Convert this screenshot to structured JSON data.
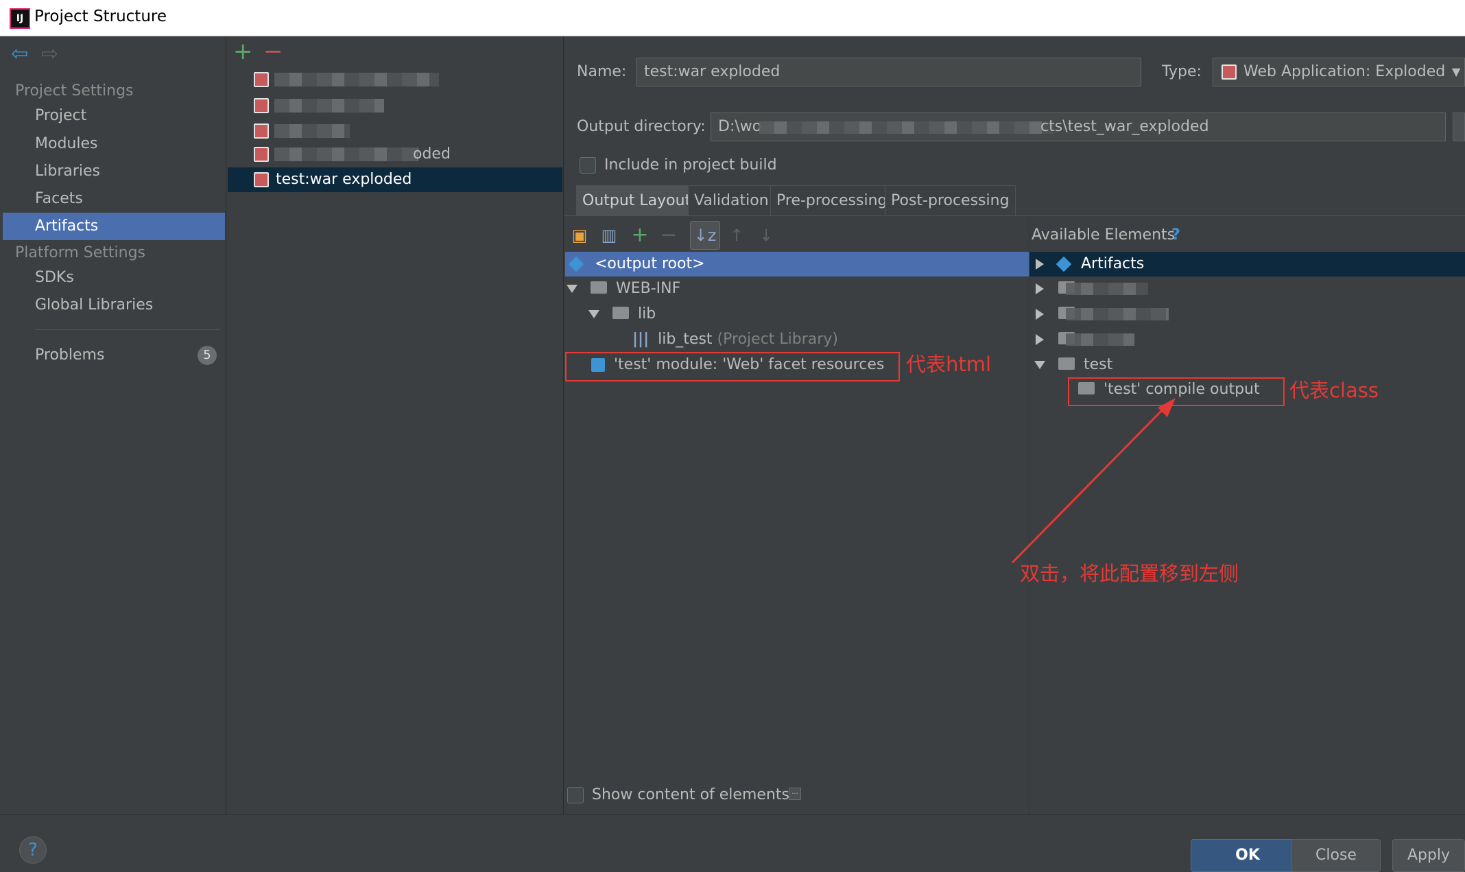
{
  "window": {
    "title": "Project Structure",
    "app_icon": "IJ"
  },
  "nav": {
    "back_icon": "back-arrow-icon",
    "forward_icon": "forward-arrow-icon",
    "project_settings_header": "Project Settings",
    "project_settings_items": [
      "Project",
      "Modules",
      "Libraries",
      "Facets",
      "Artifacts"
    ],
    "selected": "Artifacts",
    "platform_settings_header": "Platform Settings",
    "platform_settings_items": [
      "SDKs",
      "Global Libraries"
    ],
    "problems_label": "Problems",
    "problems_count": "5"
  },
  "artifacts_list": {
    "add_icon": "+",
    "remove_icon": "−",
    "items": [
      {
        "label": ""
      },
      {
        "label": ""
      },
      {
        "label": ""
      },
      {
        "label": "oded"
      },
      {
        "label": "test:war exploded"
      }
    ]
  },
  "details": {
    "name_label": "Name:",
    "name_value": "test:war exploded",
    "type_label": "Type:",
    "type_value": "Web Application: Exploded",
    "output_dir_label": "Output directory:",
    "output_dir_prefix": "D:\\wo",
    "output_dir_suffix": "cts\\test_war_exploded",
    "include_label": "Include in project build",
    "tabs": [
      "Output Layout",
      "Validation",
      "Pre-processing",
      "Post-processing"
    ],
    "selected_tab": "Output Layout"
  },
  "layout_tree": {
    "output_root": "<output root>",
    "web_inf": "WEB-INF",
    "lib": "lib",
    "lib_test": "lib_test",
    "lib_test_note": "(Project Library)",
    "facet_resources": "'test' module: 'Web' facet resources"
  },
  "available": {
    "header": "Available Elements",
    "help": "?",
    "artifacts": "Artifacts",
    "test": "test",
    "compile_output": "'test' compile output"
  },
  "annotations": {
    "html_note": "代表html",
    "class_note": "代表class",
    "double_click_note": "双击，将此配置移到左侧",
    "color": "#e53935"
  },
  "footer": {
    "show_content_label": "Show content of elements",
    "ellipsis": "...",
    "help": "?",
    "ok": "OK",
    "close": "Close",
    "apply": "Apply"
  }
}
